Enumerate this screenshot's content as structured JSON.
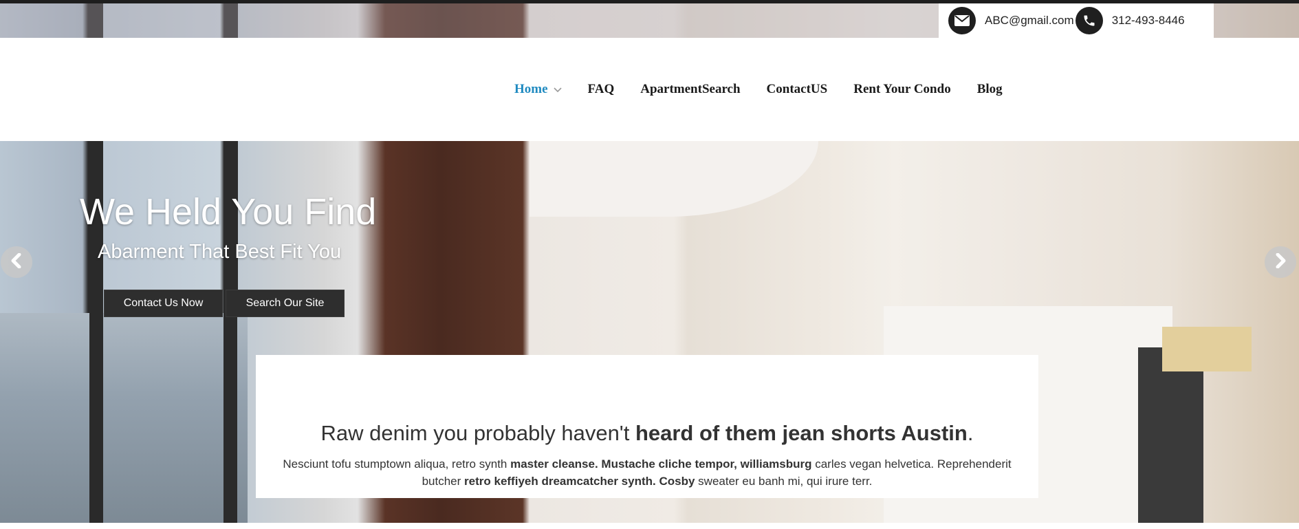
{
  "contact": {
    "email": "ABC@gmail.com",
    "phone": "312-493-8446",
    "email_icon": "envelope-icon",
    "phone_icon": "phone-icon"
  },
  "nav": {
    "items": [
      {
        "label": "Home",
        "active": true,
        "has_dropdown": true
      },
      {
        "label": "FAQ"
      },
      {
        "label": "ApartmentSearch"
      },
      {
        "label": "ContactUS"
      },
      {
        "label": "Rent Your Condo"
      },
      {
        "label": "Blog"
      }
    ],
    "active_color": "#1f8ac0"
  },
  "hero": {
    "title": "We Held You Find",
    "subtitle": "Abarment That Best Fit You",
    "buttons": {
      "contact": "Contact Us Now",
      "search": "Search Our Site"
    },
    "prev_icon": "chevron-left-icon",
    "next_icon": "chevron-right-icon"
  },
  "info": {
    "heading_normal": "Raw denim you probably haven't ",
    "heading_bold": "heard of them jean shorts Austin",
    "heading_end": ".",
    "body_1": "Nesciunt tofu stumptown aliqua, retro synth ",
    "body_2": "master cleanse. Mustache cliche tempor, williamsburg",
    "body_3": " carles vegan helvetica. Reprehenderit butcher ",
    "body_4": "retro keffiyeh dreamcatcher synth. Cosby",
    "body_5": " sweater eu banh mi, qui irure terr."
  }
}
